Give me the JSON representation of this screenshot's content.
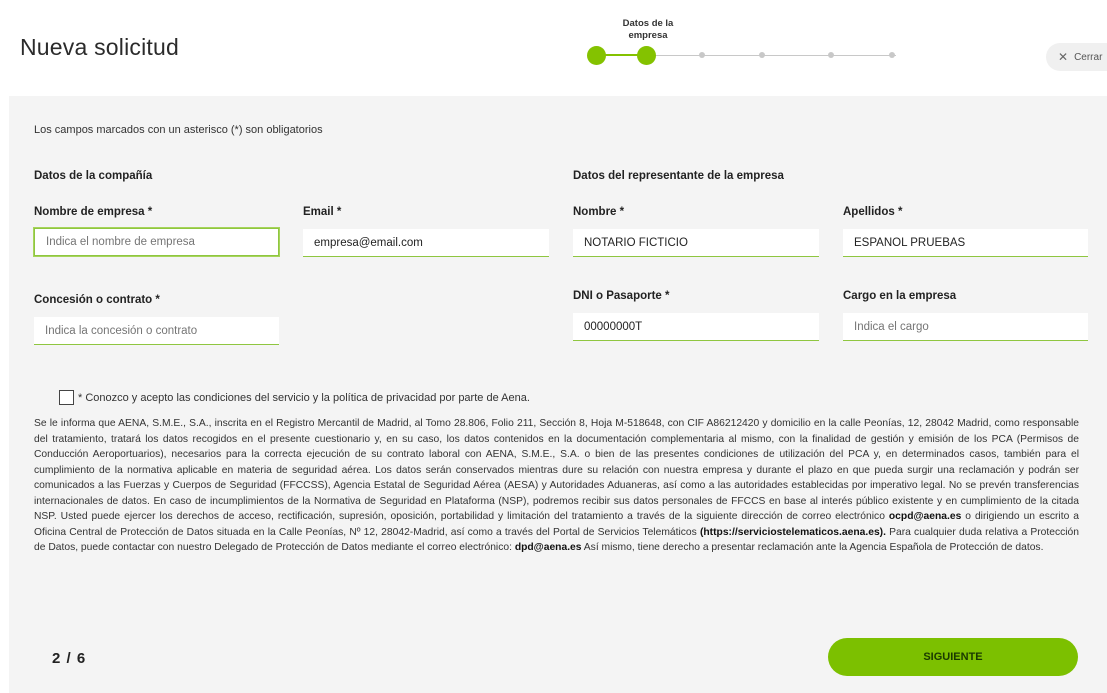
{
  "header": {
    "title": "Nueva solicitud",
    "close_label": "Cerrar"
  },
  "stepper": {
    "current_step_caption": "Datos de la empresa",
    "total_steps": 6,
    "current_step": 2
  },
  "form": {
    "required_note": "Los campos marcados con un asterisco (*) son obligatorios",
    "company_section_title": "Datos de la compañía",
    "representative_section_title": "Datos del representante de la empresa",
    "company_name": {
      "label": "Nombre de empresa *",
      "placeholder": "Indica el nombre de empresa",
      "value": ""
    },
    "email": {
      "label": "Email *",
      "placeholder": "",
      "value": "empresa@email.com"
    },
    "concession": {
      "label": "Concesión o contrato *",
      "placeholder": "Indica la concesión o contrato",
      "value": ""
    },
    "first_name": {
      "label": "Nombre *",
      "value": "NOTARIO FICTICIO"
    },
    "last_name": {
      "label": "Apellidos *",
      "value": "ESPAÑOL PRUEBAS"
    },
    "id_document": {
      "label": "DNI o Pasaporte *",
      "value": "00000000T"
    },
    "position": {
      "label": "Cargo en la empresa",
      "placeholder": "Indica el cargo",
      "value": ""
    },
    "consent_label": "* Conozco y acepto las condiciones del servicio y la política de privacidad por parte de Aena.",
    "consent_checked": false
  },
  "legal": {
    "part1": "Se le informa que AENA, S.M.E., S.A., inscrita en el Registro Mercantil de Madrid, al Tomo 28.806, Folio 211, Sección 8, Hoja M-518648, con CIF A86212420 y domicilio en la calle Peonías, 12, 28042 Madrid, como responsable del tratamiento, tratará los datos recogidos en el presente cuestionario y, en su caso, los datos contenidos en la documentación complementaria al mismo, con la finalidad de gestión y emisión de los PCA (Permisos de Conducción Aeroportuarios), necesarios para la correcta ejecución de su contrato laboral con AENA, S.M.E., S.A. o bien de las presentes condiciones de utilización del PCA y, en determinados casos, también para el cumplimiento de la normativa aplicable en materia de seguridad aérea. Los datos serán conservados mientras dure su relación con nuestra empresa y durante el plazo en que pueda surgir una reclamación y podrán ser comunicados a las Fuerzas y Cuerpos de Seguridad (FFCCSS), Agencia Estatal de Seguridad Aérea (AESA) y Autoridades Aduaneras, así como a las autoridades establecidas por imperativo legal. No se prevén transferencias internacionales de datos. En caso de incumplimientos de la Normativa de Seguridad en Plataforma (NSP), podremos recibir sus datos personales de FFCCS en base al interés público existente y en cumplimiento de la citada NSP. Usted puede ejercer los derechos de acceso, rectificación, supresión, oposición, portabilidad y limitación del tratamiento a través de la siguiente dirección de correo electrónico ",
    "email1": "ocpd@aena.es",
    "part2": " o dirigiendo un escrito a Oficina Central de Protección de Datos situada en la Calle Peonías, Nº 12, 28042-Madrid, así como a través del Portal de Servicios Telemáticos ",
    "portal": "(https://serviciostelematicos.aena.es).",
    "part3": " Para cualquier duda relativa a Protección de Datos, puede contactar con nuestro Delegado de Protección de Datos mediante el correo electrónico: ",
    "email2": "dpd@aena.es",
    "part4": " Así mismo, tiene derecho a presentar reclamación ante la Agencia Española de Protección de datos."
  },
  "footer": {
    "pager": "2 / 6",
    "next_label": "SIGUIENTE"
  },
  "colors": {
    "accent": "#84c200",
    "panel": "#f4f4f4"
  }
}
